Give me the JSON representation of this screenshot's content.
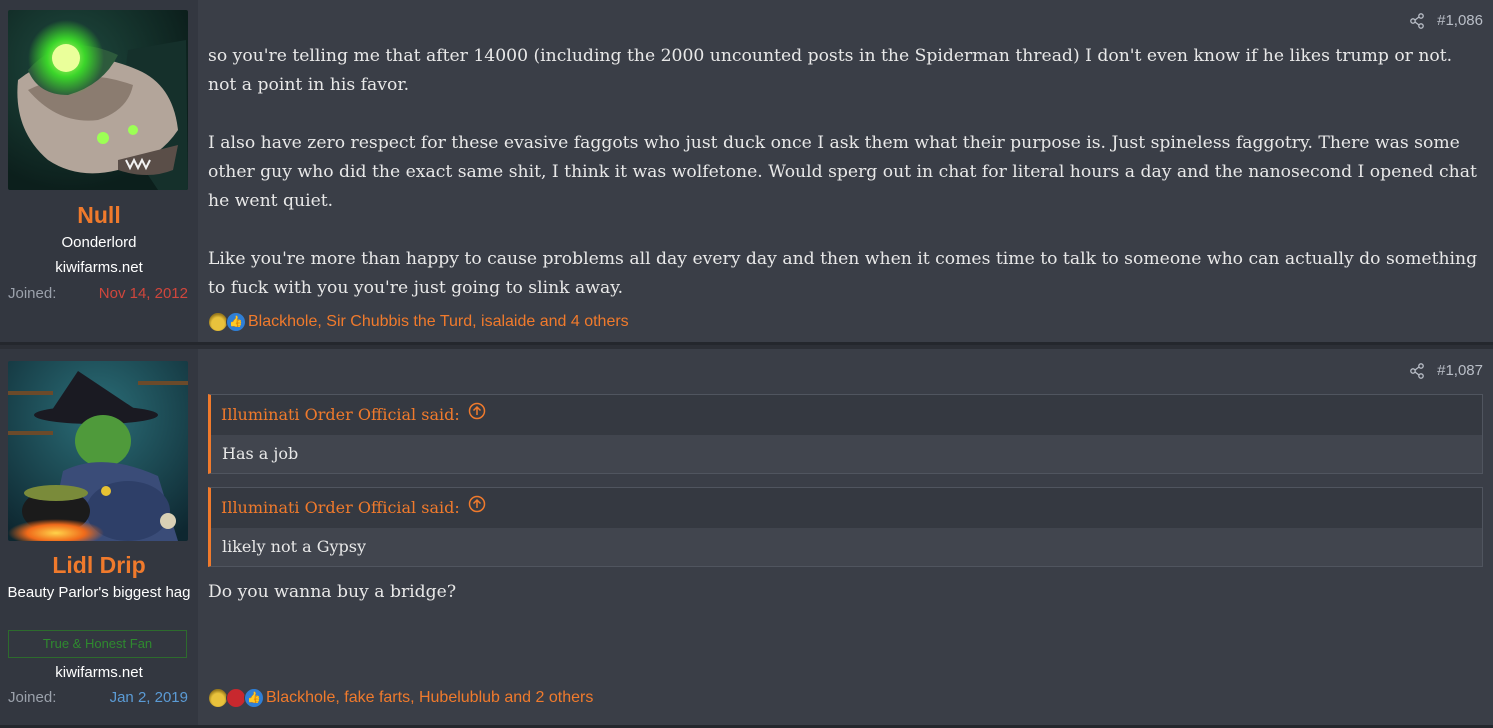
{
  "posts": [
    {
      "number": "#1,086",
      "author": {
        "name": "Null",
        "title": "Oonderlord",
        "site": "kiwifarms.net",
        "joined_label": "Joined:",
        "joined_date": "Nov 14, 2012"
      },
      "paragraphs": [
        "so you're telling me that after 14000 (including the 2000 uncounted posts in the Spiderman thread) I don't even know if he likes trump or not. not a point in his favor.",
        "I also have zero respect for these evasive faggots who just duck once I ask them what their purpose is. Just spineless faggotry. There was some other guy who did the exact same shit, I think it was wolfetone. Would sperg out in chat for literal hours a day and the nanosecond I opened chat he went quiet.",
        "Like you're more than happy to cause problems all day every day and then when it comes time to talk to someone who can actually do something to fuck with you you're just going to slink away."
      ],
      "reactions": "Blackhole, Sir Chubbis the Turd, isalaide and 4 others"
    },
    {
      "number": "#1,087",
      "author": {
        "name": "Lidl Drip",
        "title": "Beauty Parlor's biggest hag",
        "banner": "True & Honest Fan",
        "site": "kiwifarms.net",
        "joined_label": "Joined:",
        "joined_date": "Jan 2, 2019"
      },
      "quotes": [
        {
          "author": "Illuminati Order Official said:",
          "text": "Has a job"
        },
        {
          "author": "Illuminati Order Official said:",
          "text": "likely not a Gypsy"
        }
      ],
      "reply": "Do you wanna buy a bridge?",
      "reactions": "Blackhole, fake farts, Hubelublub and 2 others"
    }
  ],
  "colors": {
    "accent": "#f07a2c",
    "post_bg": "#3a3e47",
    "sidebar_bg": "#333740",
    "join_date_red": "#d0463c",
    "join_date_blue": "#5b9bd5"
  },
  "icons": [
    "share-icon",
    "quote-jump-icon",
    "reaction-medal-icon",
    "reaction-like-icon",
    "reaction-heart-icon"
  ]
}
